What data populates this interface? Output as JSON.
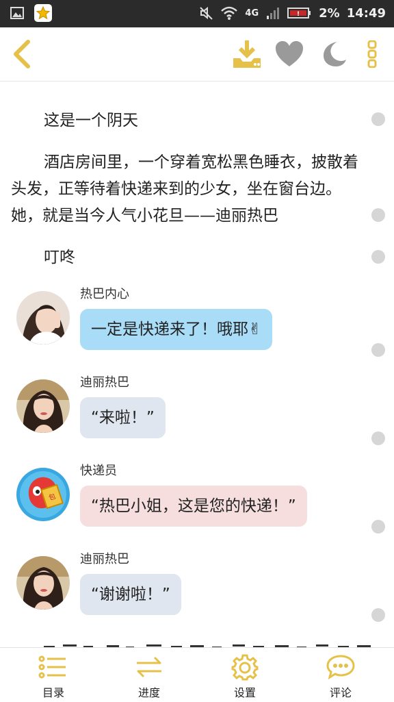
{
  "status_bar": {
    "network": "4G",
    "battery": "2%",
    "time": "14:49"
  },
  "toolbar": {
    "icons": [
      "back-icon",
      "download-icon",
      "heart-icon",
      "moon-icon",
      "more-icon"
    ],
    "accent_color": "#e6c14a"
  },
  "story": {
    "paragraphs": [
      "这是一个阴天",
      "酒店房间里，一个穿着宽松黑色睡衣，披散着头发，正等待着快递来到的少女，坐在窗台边。她，就是当今人气小花旦——迪丽热巴",
      "叮咚"
    ],
    "messages": [
      {
        "speaker": "热巴内心",
        "text": "一定是快递来了！哦耶✌"
      },
      {
        "speaker": "迪丽热巴",
        "text": "“来啦！”"
      },
      {
        "speaker": "快递员",
        "text": "“热巴小姐，这是您的快递！”"
      },
      {
        "speaker": "迪丽热巴",
        "text": "“谢谢啦！”"
      }
    ]
  },
  "bottom_nav": {
    "items": [
      {
        "label": "目录",
        "icon": "list-icon"
      },
      {
        "label": "进度",
        "icon": "progress-arrows-icon"
      },
      {
        "label": "设置",
        "icon": "gear-icon"
      },
      {
        "label": "评论",
        "icon": "comment-icon"
      }
    ]
  }
}
